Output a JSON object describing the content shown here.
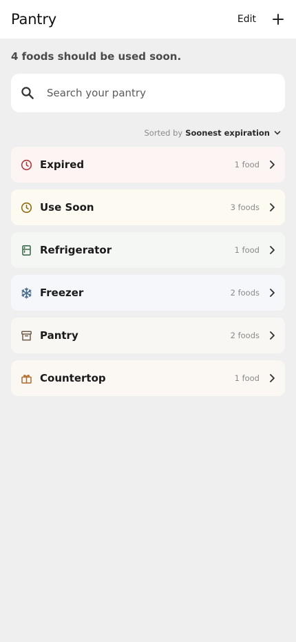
{
  "header": {
    "title": "Pantry",
    "edit_label": "Edit"
  },
  "summary": "4 foods should be used soon.",
  "search": {
    "placeholder": "Search your pantry"
  },
  "sort": {
    "prefix": "Sorted by",
    "value": "Soonest expiration"
  },
  "categories": [
    {
      "label": "Expired",
      "count": "1 food",
      "icon": "clock-icon",
      "bg": "#fdf5f4",
      "color": "#b0373e"
    },
    {
      "label": "Use Soon",
      "count": "3 foods",
      "icon": "clock-icon",
      "bg": "#fcfaf1",
      "color": "#8e6a14"
    },
    {
      "label": "Refrigerator",
      "count": "1 food",
      "icon": "fridge-icon",
      "bg": "#f5f7f4",
      "color": "#3f6b4e"
    },
    {
      "label": "Freezer",
      "count": "2 foods",
      "icon": "snowflake-icon",
      "bg": "#f5f7fa",
      "color": "#4a6b8c"
    },
    {
      "label": "Pantry",
      "count": "2 foods",
      "icon": "archive-box-icon",
      "bg": "#f8f7f3",
      "color": "#6e5a48"
    },
    {
      "label": "Countertop",
      "count": "1 food",
      "icon": "gift-box-icon",
      "bg": "#fbf7f3",
      "color": "#b06a2c"
    }
  ]
}
